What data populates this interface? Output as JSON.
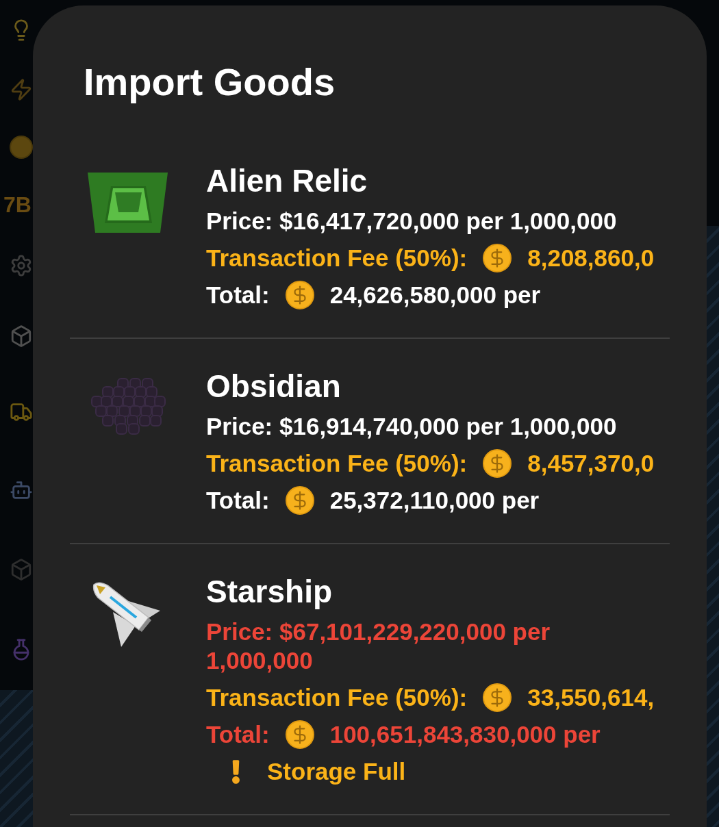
{
  "background": {
    "hud_label": "7B"
  },
  "dialog": {
    "title": "Import Goods",
    "items": [
      {
        "kind": "relic",
        "name": "Alien Relic",
        "price": "Price: $16,417,720,000 per 1,000,000",
        "fee_label": "Transaction Fee (50%):",
        "fee": "8,208,860,0",
        "total_label": "Total:",
        "total": "24,626,580,000 per",
        "affordable": true
      },
      {
        "kind": "obsidian",
        "name": "Obsidian",
        "price": "Price: $16,914,740,000 per 1,000,000",
        "fee_label": "Transaction Fee (50%):",
        "fee": "8,457,370,0",
        "total_label": "Total:",
        "total": "25,372,110,000 per",
        "affordable": true
      },
      {
        "kind": "starship",
        "name": "Starship",
        "price": "Price: $67,101,229,220,000 per 1,000,000",
        "fee_label": "Transaction Fee (50%):",
        "fee": "33,550,614,",
        "total_label": "Total:",
        "total": "100,651,843,830,000 per",
        "affordable": false,
        "alert": "Storage Full"
      }
    ]
  }
}
